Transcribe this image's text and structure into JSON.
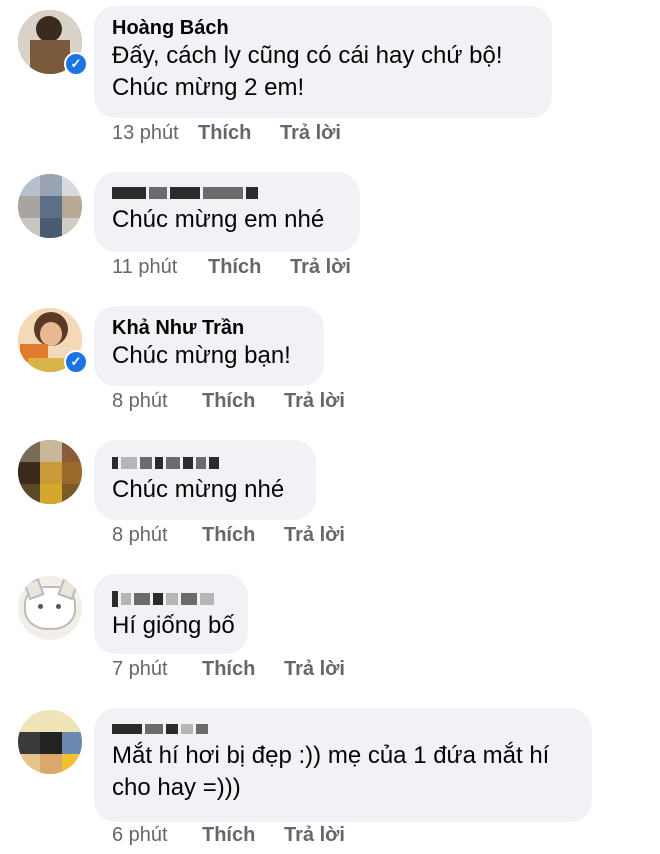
{
  "comments": [
    {
      "name": "Hoàng Bách",
      "verified": true,
      "lines": [
        "Đấy, cách ly cũng có cái hay chứ bộ!",
        "Chúc mừng 2 em!"
      ],
      "time": "13 phút",
      "like": "Thích",
      "reply": "Trả lời"
    },
    {
      "name": "",
      "verified": false,
      "lines": [
        "Chúc mừng em nhé"
      ],
      "time": "11 phút",
      "like": "Thích",
      "reply": "Trả lời"
    },
    {
      "name": "Khả Như Trần",
      "verified": true,
      "lines": [
        "Chúc mừng bạn!"
      ],
      "time": "8 phút",
      "like": "Thích",
      "reply": "Trả lời"
    },
    {
      "name": "",
      "verified": false,
      "lines": [
        "Chúc mừng nhé"
      ],
      "time": "8 phút",
      "like": "Thích",
      "reply": "Trả lời"
    },
    {
      "name": "",
      "verified": false,
      "lines": [
        "Hí giống bố"
      ],
      "time": "7 phút",
      "like": "Thích",
      "reply": "Trả lời"
    },
    {
      "name": "",
      "verified": false,
      "lines": [
        "Mắt hí hơi bị đẹp :)) mẹ của 1 đứa mắt hí",
        "cho hay =)))"
      ],
      "time": "6 phút",
      "like": "Thích",
      "reply": "Trả lời"
    }
  ],
  "icons": {
    "verified": "check-icon"
  }
}
